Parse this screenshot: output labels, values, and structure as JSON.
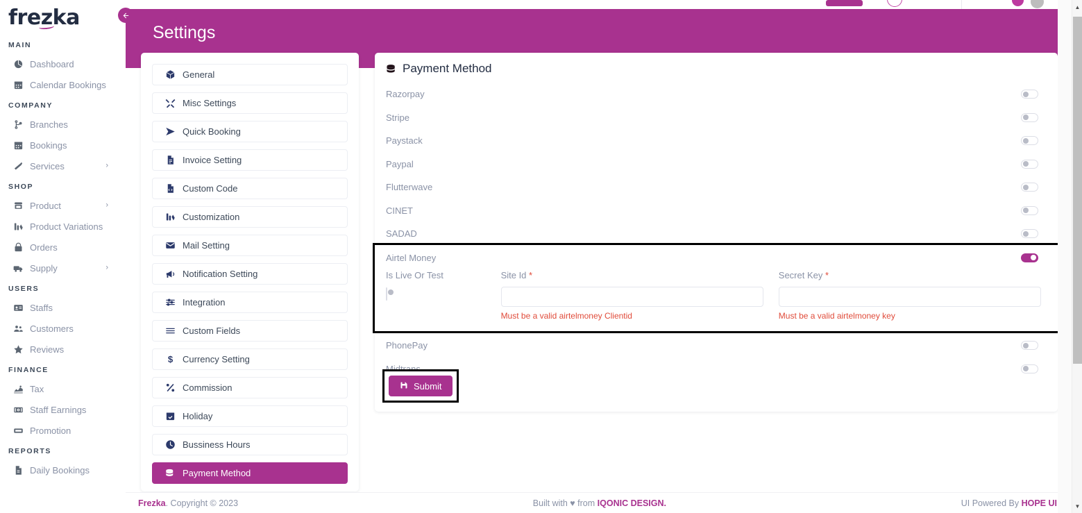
{
  "brand": {
    "name": "frezka"
  },
  "sidebar": {
    "sections": [
      {
        "title": "MAIN",
        "items": [
          {
            "label": "Dashboard",
            "icon": "dashboard-icon",
            "chevron": false
          },
          {
            "label": "Calendar Bookings",
            "icon": "calendar-icon",
            "chevron": false
          }
        ]
      },
      {
        "title": "COMPANY",
        "items": [
          {
            "label": "Branches",
            "icon": "branch-icon",
            "chevron": false
          },
          {
            "label": "Bookings",
            "icon": "calendar-icon",
            "chevron": false
          },
          {
            "label": "Services",
            "icon": "services-icon",
            "chevron": true
          }
        ]
      },
      {
        "title": "SHOP",
        "items": [
          {
            "label": "Product",
            "icon": "store-icon",
            "chevron": true
          },
          {
            "label": "Product Variations",
            "icon": "variations-icon",
            "chevron": false
          },
          {
            "label": "Orders",
            "icon": "bag-icon",
            "chevron": false
          },
          {
            "label": "Supply",
            "icon": "truck-icon",
            "chevron": true
          }
        ]
      },
      {
        "title": "USERS",
        "items": [
          {
            "label": "Staffs",
            "icon": "id-card-icon",
            "chevron": false
          },
          {
            "label": "Customers",
            "icon": "users-icon",
            "chevron": false
          },
          {
            "label": "Reviews",
            "icon": "star-icon",
            "chevron": false
          }
        ]
      },
      {
        "title": "FINANCE",
        "items": [
          {
            "label": "Tax",
            "icon": "tax-icon",
            "chevron": false
          },
          {
            "label": "Staff Earnings",
            "icon": "money-icon",
            "chevron": false
          },
          {
            "label": "Promotion",
            "icon": "ticket-icon",
            "chevron": false
          }
        ]
      },
      {
        "title": "REPORTS",
        "items": [
          {
            "label": "Daily Bookings",
            "icon": "report-icon",
            "chevron": false
          }
        ]
      }
    ]
  },
  "header": {
    "title": "Settings",
    "back_icon": "arrow-left-icon",
    "bg_color": "#a8328f"
  },
  "settings_menu": {
    "items": [
      {
        "label": "General",
        "icon": "box-icon",
        "active": false
      },
      {
        "label": "Misc Settings",
        "icon": "tools-icon",
        "active": false
      },
      {
        "label": "Quick Booking",
        "icon": "send-icon",
        "active": false
      },
      {
        "label": "Invoice Setting",
        "icon": "invoice-icon",
        "active": false
      },
      {
        "label": "Custom Code",
        "icon": "code-file-icon",
        "active": false
      },
      {
        "label": "Customization",
        "icon": "customization-icon",
        "active": false
      },
      {
        "label": "Mail Setting",
        "icon": "mail-icon",
        "active": false
      },
      {
        "label": "Notification Setting",
        "icon": "megaphone-icon",
        "active": false
      },
      {
        "label": "Integration",
        "icon": "sliders-icon",
        "active": false
      },
      {
        "label": "Custom Fields",
        "icon": "list-icon",
        "active": false
      },
      {
        "label": "Currency Setting",
        "icon": "dollar-icon",
        "active": false
      },
      {
        "label": "Commission",
        "icon": "percent-icon",
        "active": false
      },
      {
        "label": "Holiday",
        "icon": "calendar-check-icon",
        "active": false
      },
      {
        "label": "Bussiness Hours",
        "icon": "clock-icon",
        "active": false
      },
      {
        "label": "Payment Method",
        "icon": "coins-icon",
        "active": true
      }
    ]
  },
  "payment_panel": {
    "title": "Payment Method",
    "title_icon": "coins-icon",
    "rows_top": [
      {
        "label": "Razorpay",
        "enabled": false
      },
      {
        "label": "Stripe",
        "enabled": false
      },
      {
        "label": "Paystack",
        "enabled": false
      },
      {
        "label": "Paypal",
        "enabled": false
      },
      {
        "label": "Flutterwave",
        "enabled": false
      },
      {
        "label": "CINET",
        "enabled": false
      },
      {
        "label": "SADAD",
        "enabled": false
      }
    ],
    "expanded": {
      "label": "Airtel Money",
      "enabled": true,
      "highlighted": true,
      "fields": [
        {
          "label": "Is Live Or Test",
          "required": false,
          "type": "toggle",
          "value": "",
          "enabled": false
        },
        {
          "label": "Site Id",
          "required": true,
          "type": "text",
          "value": "",
          "placeholder": "",
          "error": "Must be a valid airtelmoney Clientid"
        },
        {
          "label": "Secret Key",
          "required": true,
          "type": "text",
          "value": "",
          "placeholder": "",
          "error": "Must be a valid airtelmoney key"
        }
      ]
    },
    "rows_bottom": [
      {
        "label": "PhonePay",
        "enabled": false
      },
      {
        "label": "Midtrans",
        "enabled": false
      }
    ],
    "submit": {
      "label": "Submit",
      "icon": "save-icon",
      "highlighted": true
    }
  },
  "footer": {
    "brand": "Frezka",
    "copyright": ". Copyright © 2023",
    "built_prefix": "Built with ",
    "built_heart": "♥",
    "built_mid": " from ",
    "built_company": "IQONIC DESIGN.",
    "powered_prefix": "UI Powered By ",
    "powered_company": "HOPE UI"
  },
  "colors": {
    "accent": "#a8328f",
    "error": "#e04b3a",
    "muted": "#8a92a6",
    "dark": "#232d42"
  }
}
